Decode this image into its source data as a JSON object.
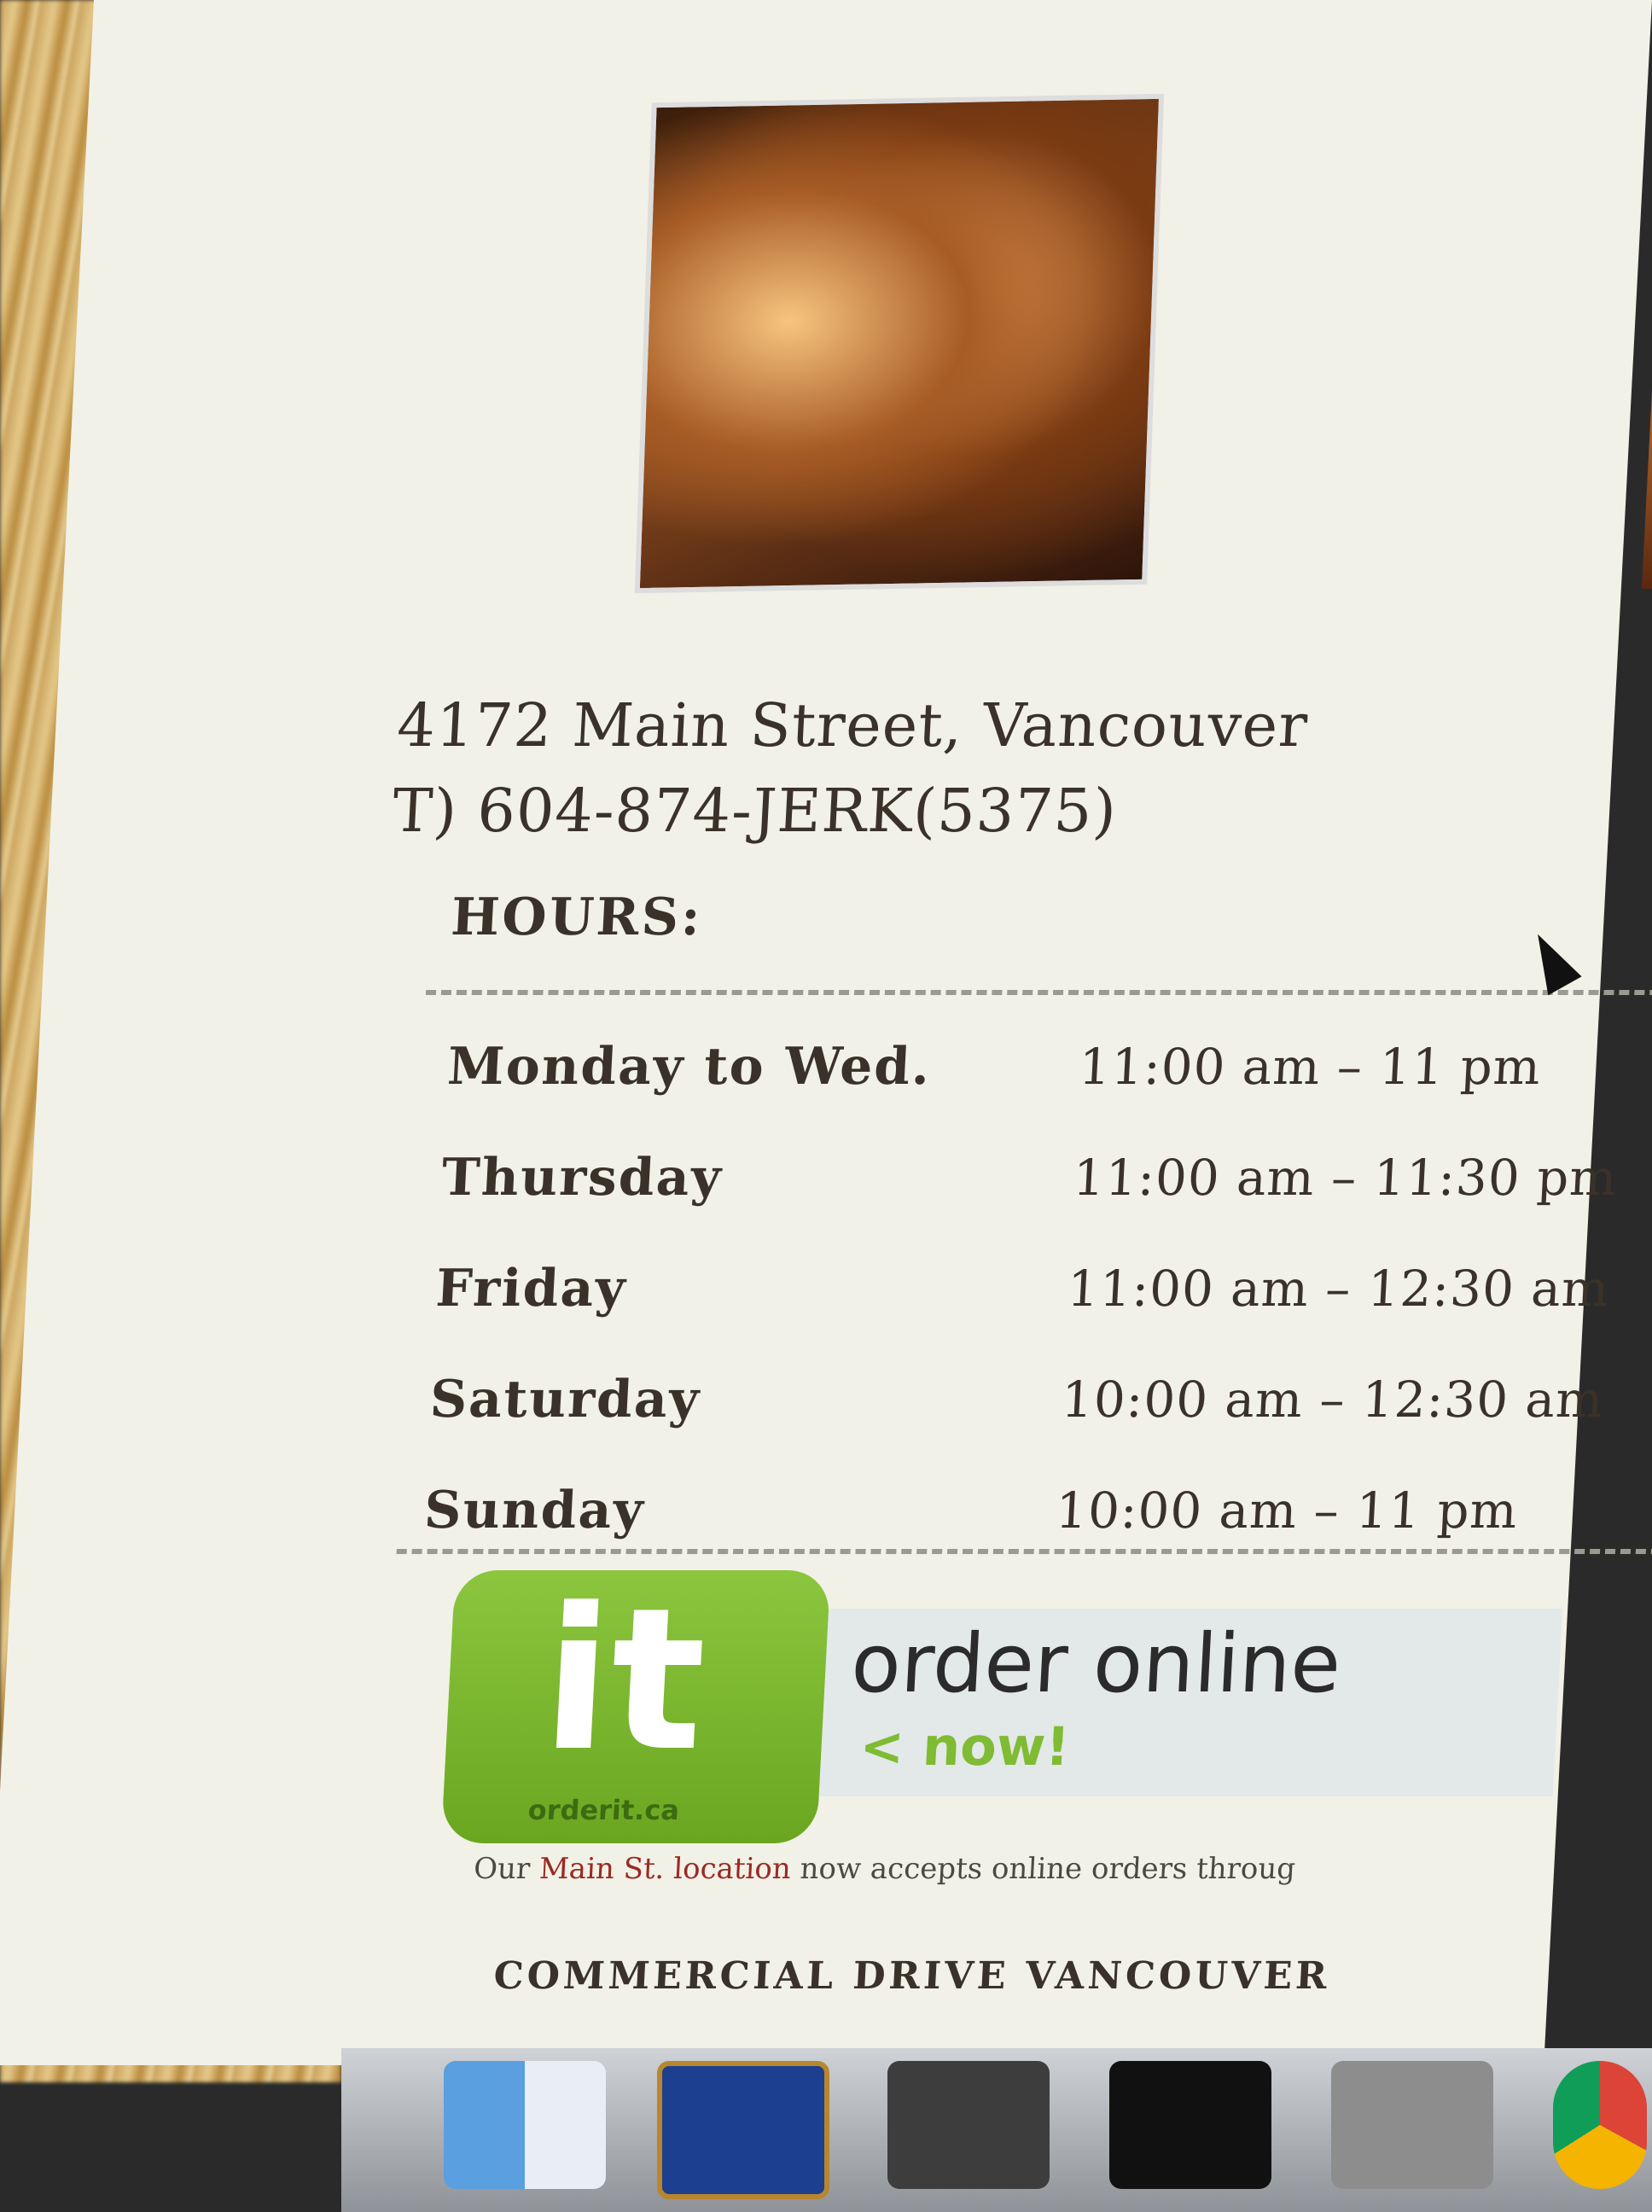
{
  "restaurant": {
    "address": "4172 Main Street, Vancouver",
    "phone": "T) 604-874-JERK(5375)"
  },
  "hours": {
    "title": "HOURS:",
    "rows": [
      {
        "day": "Monday to Wed.",
        "time": "11:00 am – 11 pm"
      },
      {
        "day": "Thursday",
        "time": "11:00 am – 11:30 pm"
      },
      {
        "day": "Friday",
        "time": "11:00 am – 12:30 am"
      },
      {
        "day": "Saturday",
        "time": "10:00 am – 12:30 am"
      },
      {
        "day": "Sunday",
        "time": "10:00 am – 11 pm"
      }
    ]
  },
  "order_banner": {
    "badge_text": "it",
    "badge_site": "orderit.ca",
    "title": "order online",
    "subtitle": "< now!"
  },
  "notice": {
    "prefix": "Our ",
    "highlight": "Main St. location",
    "suffix": " now accepts online orders throug"
  },
  "location_heading": "COMMERCIAL DRIVE VANCOUVER",
  "dock": {
    "items": [
      "finder-icon",
      "l-app-icon",
      "sublime-icon",
      "terminal-icon",
      "window-icon",
      "chrome-icon"
    ]
  },
  "colors": {
    "accent_green": "#8cc63f",
    "notice_accent": "#9a2a22",
    "page_bg": "#f2f1e7"
  }
}
